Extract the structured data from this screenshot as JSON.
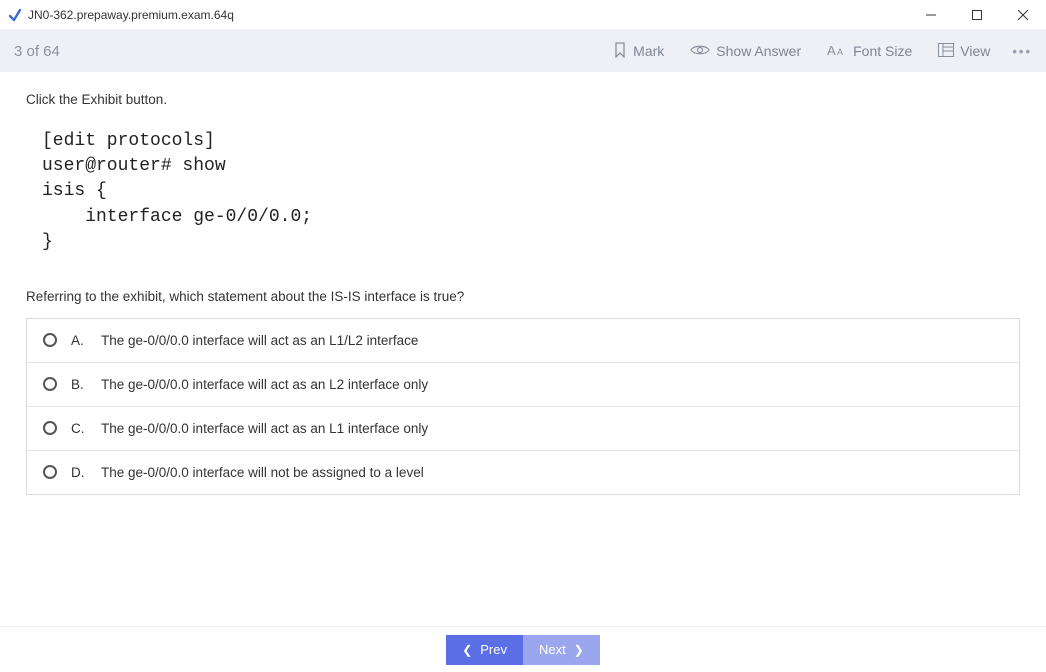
{
  "window": {
    "title": "JN0-362.prepaway.premium.exam.64q"
  },
  "toolbar": {
    "counter": "3 of 64",
    "mark": "Mark",
    "show_answer": "Show Answer",
    "font_size": "Font Size",
    "view": "View"
  },
  "question": {
    "instruction": "Click the Exhibit button.",
    "exhibit": "[edit protocols]\nuser@router# show\nisis {\n    interface ge-0/0/0.0;\n}",
    "prompt": "Referring to the exhibit, which statement about the IS-IS interface is true?",
    "options": [
      {
        "letter": "A.",
        "text": "The ge-0/0/0.0 interface will act as an L1/L2 interface"
      },
      {
        "letter": "B.",
        "text": "The ge-0/0/0.0 interface will act as an L2 interface only"
      },
      {
        "letter": "C.",
        "text": "The ge-0/0/0.0 interface will act as an L1 interface only"
      },
      {
        "letter": "D.",
        "text": "The ge-0/0/0.0 interface will not be assigned to a level"
      }
    ]
  },
  "footer": {
    "prev": "Prev",
    "next": "Next"
  }
}
